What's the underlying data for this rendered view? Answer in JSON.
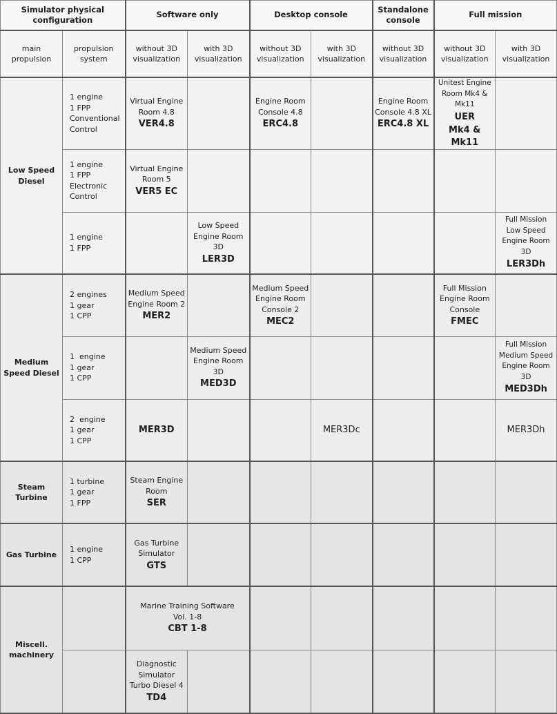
{
  "header": {
    "groups": [
      "Simulator physical configuration",
      "Software only",
      "Desktop console",
      "Standalone console",
      "Full mission"
    ],
    "subheaders": [
      "main propulsion",
      "propulsion system",
      "without 3D visualization",
      "with 3D visualization",
      "without 3D visualization",
      "with 3D visualization",
      "without 3D visualization",
      "without 3D visualization",
      "with 3D visualization"
    ]
  },
  "main_propulsion": {
    "low_speed_diesel": "Low Speed Diesel",
    "medium_speed_diesel": "Medium Speed Diesel",
    "steam_turbine": "Steam Turbine",
    "gas_turbine": "Gas Turbine",
    "miscellaneous": "Miscell. machinery"
  },
  "rows": {
    "lsd_conventional": {
      "propulsion_system": [
        "1 engine",
        "1 FPP",
        "Conventional",
        "Control"
      ],
      "software_no3d": {
        "desc": "Virtual Engine Room 4.8",
        "code": "VER4.8"
      },
      "desktop_no3d": {
        "desc": "Engine Room Console 4.8",
        "code": "ERC4.8"
      },
      "standalone_no3d": {
        "desc": "Engine Room Console 4.8 XL",
        "code": "ERC4.8 XL"
      },
      "fullmission_no3d": {
        "desc": "Unitest Engine Room Mk4 & Mk11",
        "code": "UER",
        "code2": "Mk4 & Mk11"
      }
    },
    "lsd_electronic": {
      "propulsion_system": [
        "1 engine",
        "1 FPP",
        "Electronic",
        "Control"
      ],
      "software_no3d": {
        "desc": "Virtual Engine Room 5",
        "code": "VER5 EC"
      }
    },
    "lsd_3d": {
      "propulsion_system": [
        "1 engine",
        "1 FPP"
      ],
      "software_3d": {
        "desc": "Low Speed Engine Room 3D",
        "code": "LER3D"
      },
      "fullmission_3d": {
        "desc": "Full Mission Low Speed Engine Room 3D",
        "code": "LER3Dh"
      }
    },
    "msd_2engines": {
      "propulsion_system": [
        "2 engines",
        "1 gear",
        "1 CPP"
      ],
      "software_no3d": {
        "desc": "Medium Speed Engine Room 2",
        "code": "MER2"
      },
      "desktop_no3d": {
        "desc": "Medium Speed Engine Room Console 2",
        "code": "MEC2"
      },
      "fullmission_no3d": {
        "desc": "Full Mission Engine Room Console",
        "code": "FMEC"
      }
    },
    "msd_1engine": {
      "propulsion_system": [
        "1  engine",
        "1 gear",
        "1 CPP"
      ],
      "software_3d": {
        "desc": "Medium Speed Engine Room 3D",
        "code": "MED3D"
      },
      "fullmission_3d": {
        "desc": "Full Mission Medium Speed Engine Room 3D",
        "code": "MED3Dh"
      }
    },
    "msd_2engine_3d": {
      "propulsion_system": [
        "2  engine",
        "1 gear",
        "1 CPP"
      ],
      "software_no3d": {
        "code": "MER3D"
      },
      "desktop_3d": {
        "code": "MER3Dc"
      },
      "fullmission_3d": {
        "code": "MER3Dh"
      }
    },
    "steam": {
      "propulsion_system": [
        "1 turbine",
        "1 gear",
        "1 FPP"
      ],
      "software_no3d": {
        "desc": "Steam Engine Room",
        "code": "SER"
      }
    },
    "gas": {
      "propulsion_system": [
        "1 engine",
        "1 CPP"
      ],
      "software_no3d": {
        "desc": "Gas Turbine Simulator",
        "code": "GTS"
      }
    },
    "misc_cbt": {
      "software_both": {
        "desc": "Marine Training Software Vol. 1-8",
        "code": "CBT 1-8"
      }
    },
    "misc_td4": {
      "software_no3d": {
        "desc": "Diagnostic Simulator Turbo Diesel 4",
        "code": "TD4"
      }
    }
  }
}
